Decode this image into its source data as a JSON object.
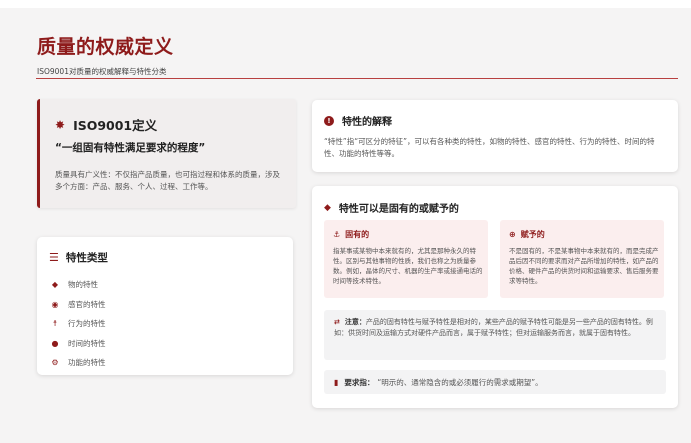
{
  "header": {
    "title": "质量的权威定义",
    "subtitle": "ISO9001对质量的权威解释与特性分类"
  },
  "definition": {
    "title": "ISO9001定义",
    "quote": "“一组固有特性满足要求的程度”",
    "description": "质量具有广义性：不仅指产品质量，也可指过程和体系的质量，涉及多个方面：产品、服务、个人、过程、工作等。"
  },
  "char_types": {
    "title": "特性类型",
    "items": [
      {
        "label": "物的特性",
        "icon": "cube-icon"
      },
      {
        "label": "感官的特性",
        "icon": "eye-icon"
      },
      {
        "label": "行为的特性",
        "icon": "person-running-icon"
      },
      {
        "label": "时间的特性",
        "icon": "clock-icon"
      },
      {
        "label": "功能的特性",
        "icon": "gears-icon"
      }
    ]
  },
  "explanation": {
    "title": "特性的解释",
    "body": "“特性”指“可区分的特征”，可以有各种类的特性，如物的特性、感官的特性、行为的特性、时间的特性、功能的特性等等。"
  },
  "inherent_assigned": {
    "title": "特性可以是固有的或赋予的",
    "inherent": {
      "title": "固有的",
      "body": "指某事或某物中本来就有的，尤其是那种永久的特性。区别与其他事物的性质，我们也称之为质量参数。例如，晶体的尺寸、机器的生产率或接通电话的时间等技术特性。"
    },
    "assigned": {
      "title": "赋予的",
      "body": "不是固有的，不是某事物中本来就有的，而是完成产品后因不同的要求而对产品所增加的特性，如产品的价格、硬件产品的供货时间和运输要求、售后服务要求等特性。"
    },
    "note": {
      "label": "注意：",
      "body": "产品的固有特性与赋予特性是相对的，某些产品的赋予特性可能是另一些产品的固有特性。例如：供货时间及运输方式对硬件产品而言，属于赋予特性；但对运输服务而言，就属于固有特性。"
    },
    "requirement": {
      "label": "要求指：",
      "body": "“明示的、通常隐含的或必须履行的需求或期望”。"
    }
  },
  "colors": {
    "accent": "#8e1b1b",
    "background": "#f5f4f4",
    "pink_box": "#fbeeee"
  }
}
